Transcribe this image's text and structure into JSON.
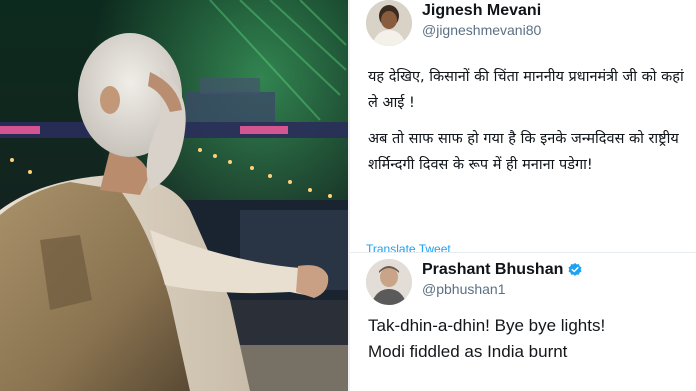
{
  "tweet1": {
    "display_name": "Jignesh Mevani",
    "handle": "@jigneshmevani80",
    "paragraphs": [
      "यह देखिए, किसानों की चिंता माननीय प्रधानमंत्री जी को कहां ले आई !",
      "अब तो साफ साफ हो गया है कि इनके जन्मदिवस को राष्ट्रीय शर्मिन्दगी दिवस के रूप में ही मनाना पडेगा!"
    ],
    "translate_label": "Translate Tweet"
  },
  "tweet2": {
    "display_name": "Prashant Bhushan",
    "handle": "@pbhushan1",
    "lines": [
      "Tak-dhin-a-dhin! Bye bye lights!",
      "Modi fiddled as India burnt"
    ],
    "verified_icon": "verified-badge-icon"
  },
  "colors": {
    "link": "#1da1f2",
    "handle": "#5b7083",
    "text": "#0f1419"
  }
}
